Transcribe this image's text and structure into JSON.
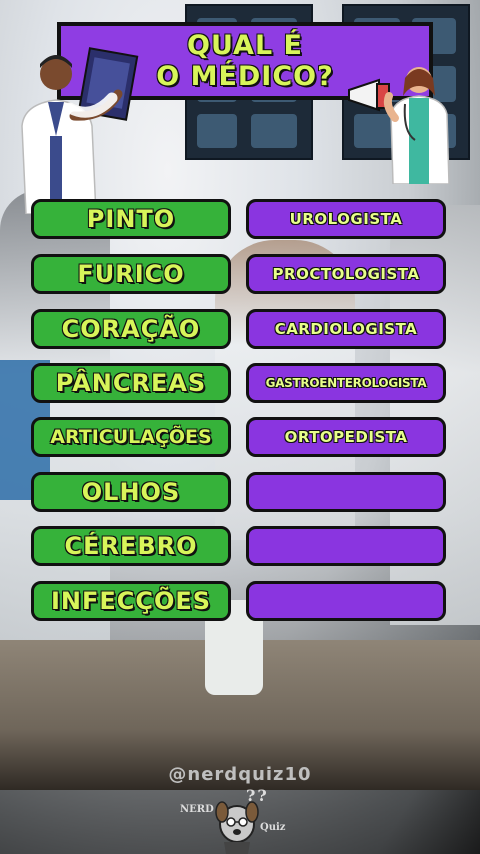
{
  "title": {
    "line1": "QUAL É",
    "line2": "O MÉDICO?"
  },
  "rows": [
    {
      "organ": "PINTO",
      "doctor": "UROLOGISTA"
    },
    {
      "organ": "FURICO",
      "doctor": "PROCTOLOGISTA"
    },
    {
      "organ": "CORAÇÃO",
      "doctor": "CARDIOLOGISTA"
    },
    {
      "organ": "PÂNCREAS",
      "doctor": "GASTROENTEROLOGISTA"
    },
    {
      "organ": "ARTICULAÇÕES",
      "doctor": "ORTOPEDISTA"
    },
    {
      "organ": "OLHOS",
      "doctor": ""
    },
    {
      "organ": "CÉREBRO",
      "doctor": ""
    },
    {
      "organ": "INFECÇÕES",
      "doctor": ""
    }
  ],
  "footer": {
    "handle": "@nerdquiz10",
    "logo_left": "NERD",
    "logo_right": "Quiz",
    "logo_marks": "??"
  },
  "colors": {
    "title_bg": "#8f3de3",
    "text_yellow": "#d8f55a",
    "organ_bg": "#36b23a",
    "doctor_bg": "#8a35e0"
  },
  "icons": [
    "male-doctor-with-xray-icon",
    "female-doctor-with-megaphone-icon",
    "dog-mascot-icon"
  ]
}
